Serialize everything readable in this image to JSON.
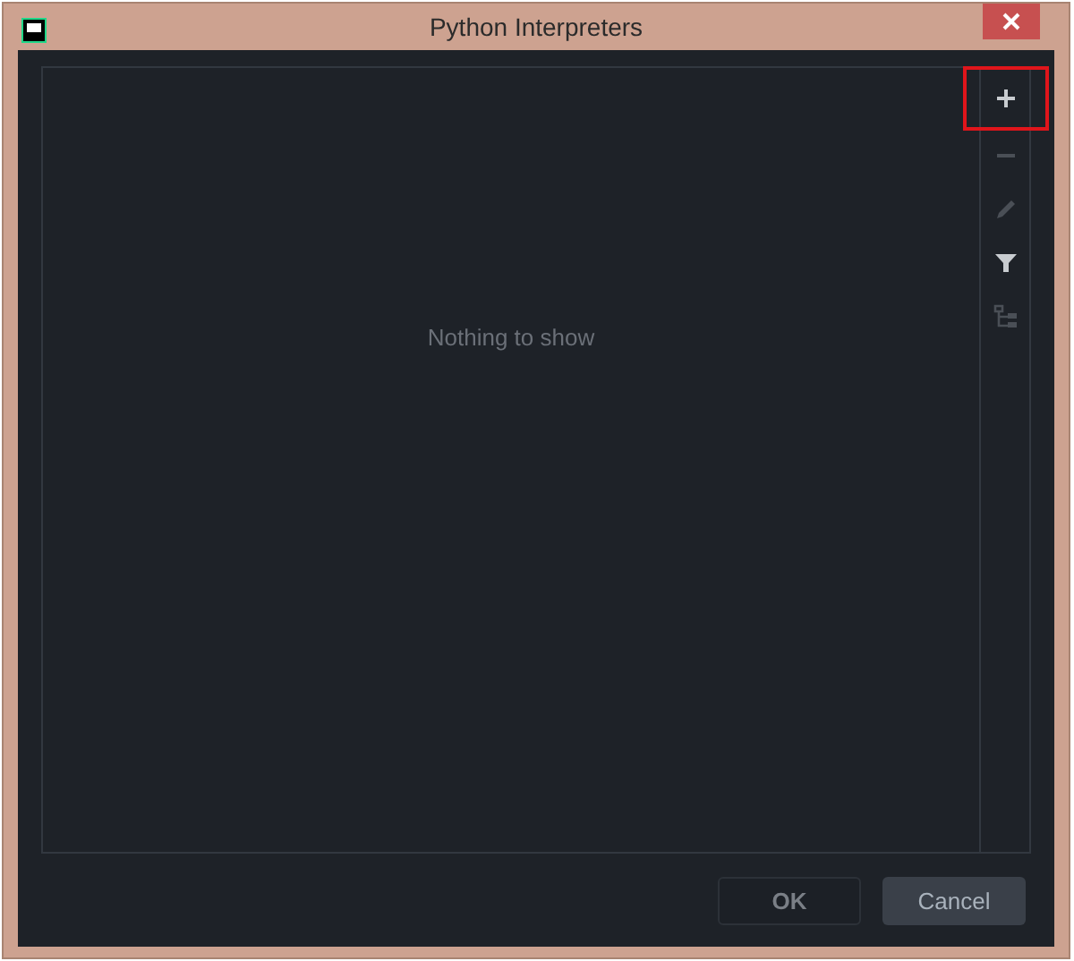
{
  "window": {
    "title": "Python Interpreters"
  },
  "list": {
    "empty_text": "Nothing to show"
  },
  "toolbar": [
    {
      "kind": "add",
      "disabled": false,
      "highlighted": true
    },
    {
      "kind": "remove",
      "disabled": true,
      "highlighted": false
    },
    {
      "kind": "edit",
      "disabled": true,
      "highlighted": false
    },
    {
      "kind": "filter",
      "disabled": false,
      "highlighted": false
    },
    {
      "kind": "tree",
      "disabled": true,
      "highlighted": false
    }
  ],
  "buttons": [
    {
      "label": "OK",
      "disabled": true
    },
    {
      "label": "Cancel",
      "disabled": false
    }
  ]
}
